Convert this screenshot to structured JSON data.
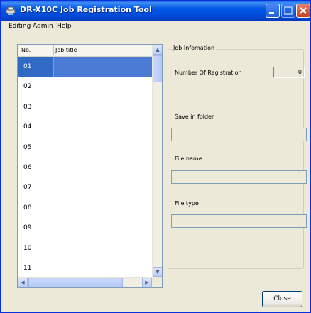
{
  "window": {
    "title": "DR-X10C Job Registration Tool"
  },
  "menu": {
    "items": [
      {
        "label": "Editing"
      },
      {
        "label": "Admin"
      },
      {
        "label": "Help"
      }
    ]
  },
  "list": {
    "columns": [
      "No.",
      "Job title"
    ],
    "rows": [
      "01",
      "02",
      "03",
      "04",
      "05",
      "06",
      "07",
      "08",
      "09",
      "10",
      "11"
    ],
    "selected_index": 0
  },
  "job_info": {
    "group_title": "Job Infomation",
    "number_label": "Number Of Registration",
    "number_value": "0",
    "save_label": "Save in folder",
    "save_value": "",
    "file_name_label": "File name",
    "file_name_value": "",
    "file_type_label": "File type",
    "file_type_value": ""
  },
  "buttons": {
    "close": "Close"
  },
  "colors": {
    "titlebar": "#0058e6",
    "selection": "#316ac5",
    "face": "#ece9d8"
  }
}
